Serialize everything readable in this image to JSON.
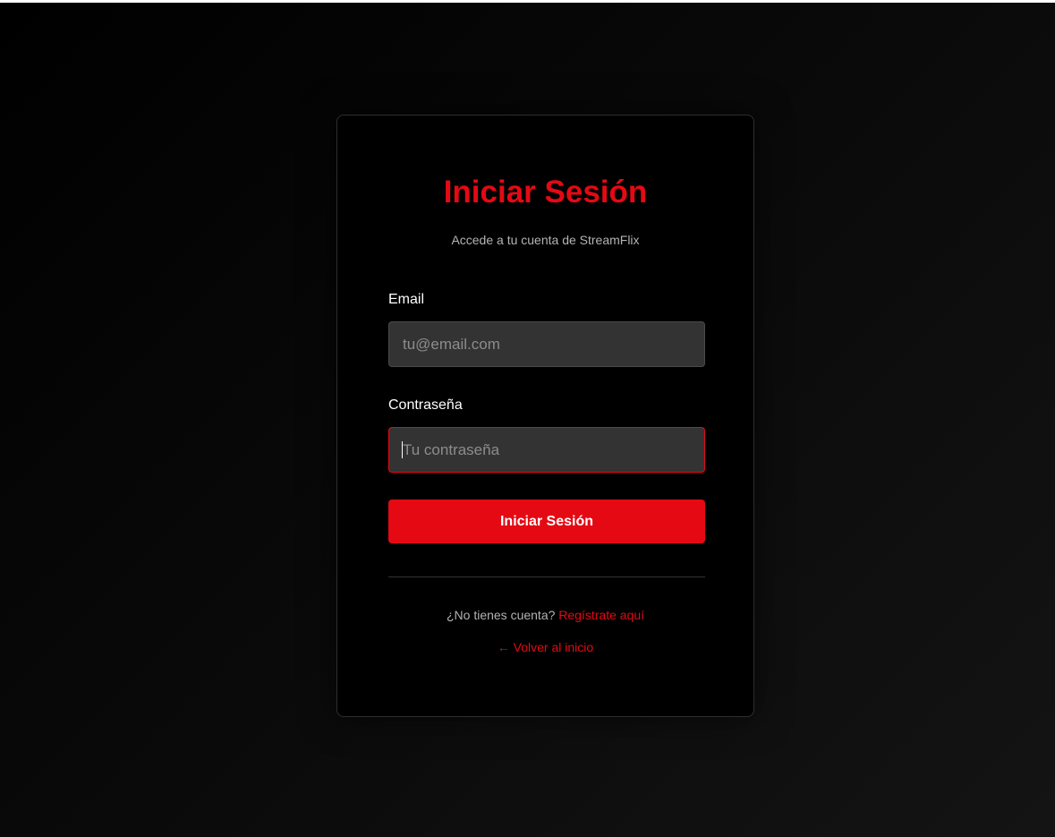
{
  "login": {
    "title": "Iniciar Sesión",
    "subtitle": "Accede a tu cuenta de StreamFlix",
    "email_label": "Email",
    "email_placeholder": "tu@email.com",
    "email_value": "",
    "password_label": "Contraseña",
    "password_placeholder": "Tu contraseña",
    "password_value": "",
    "submit_label": "Iniciar Sesión",
    "no_account_text": "¿No tienes cuenta?",
    "register_link": "Regístrate aquí",
    "back_link": "← Volver al inicio"
  },
  "colors": {
    "accent": "#e50914",
    "background": "#000000",
    "input_background": "#333333",
    "muted_text": "#b3b3b3"
  }
}
